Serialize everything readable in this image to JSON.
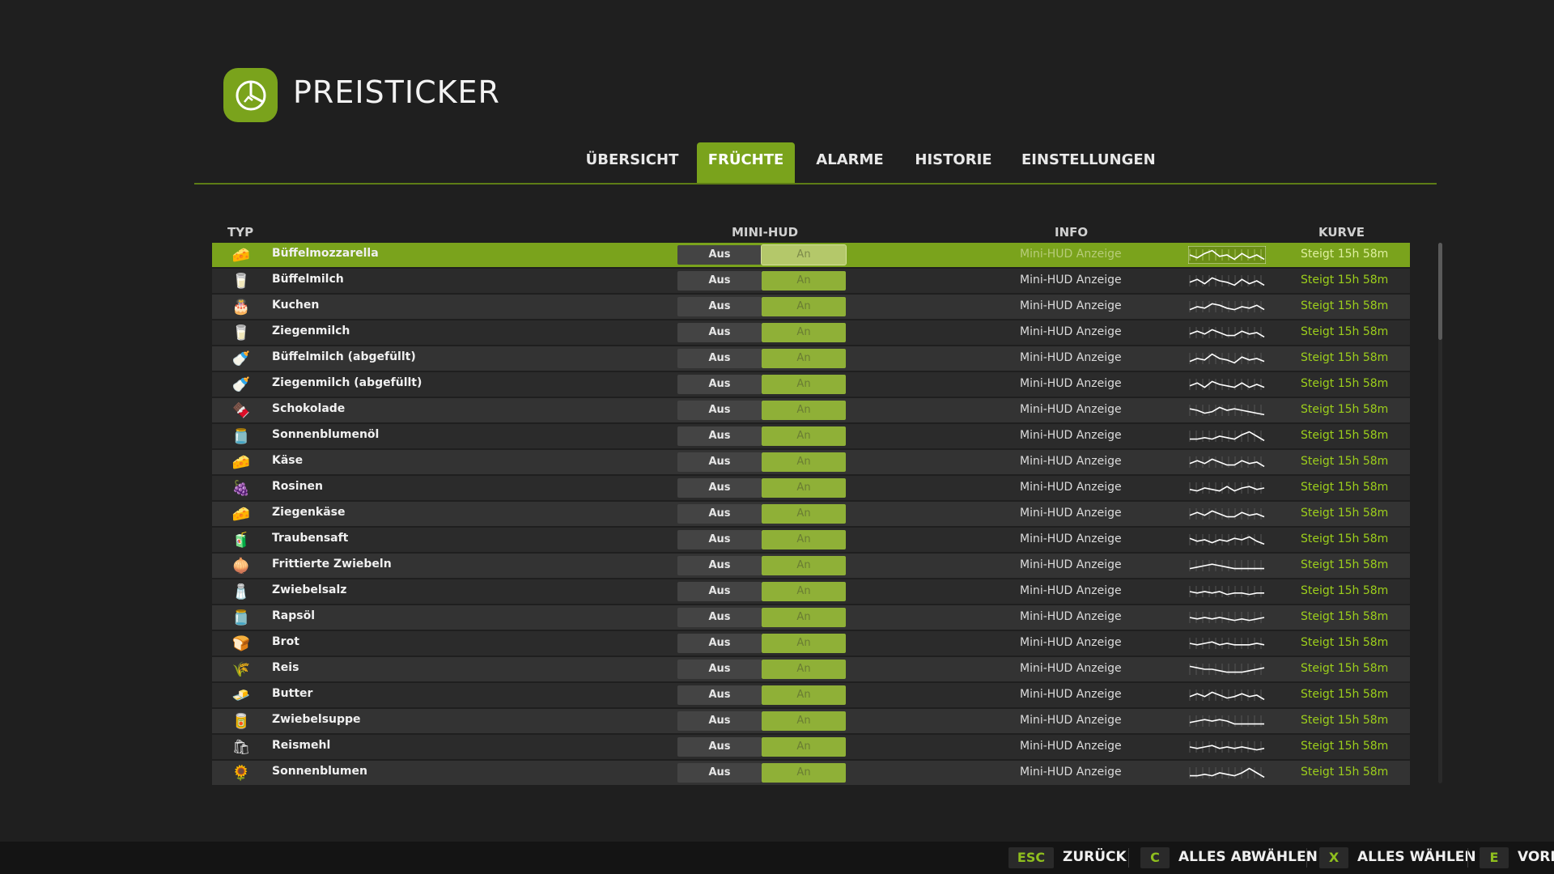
{
  "app": {
    "title": "PREISTICKER"
  },
  "tabs": [
    {
      "label": "ÜBERSICHT",
      "active": false
    },
    {
      "label": "FRÜCHTE",
      "active": true
    },
    {
      "label": "ALARME",
      "active": false
    },
    {
      "label": "HISTORIE",
      "active": false
    },
    {
      "label": "EINSTELLUNGEN",
      "active": false
    }
  ],
  "columns": {
    "typ": "TYP",
    "minihud": "MINI-HUD",
    "info": "INFO",
    "kurve": "KURVE"
  },
  "colors": {
    "accent": "#7aa31c",
    "trend": "#9dcf1c",
    "background": "#1f1f1f"
  },
  "rows": [
    {
      "name": "Büffelmozzarella",
      "icon": "mozzarella-icon",
      "glyph": "🧀",
      "off": "Aus",
      "on": "An",
      "info": "Mini-HUD Anzeige",
      "trend": "Steigt 15h 58m",
      "curve": [
        0.5,
        0.3,
        0.6,
        0.8,
        0.4,
        0.5,
        0.2,
        0.6,
        0.3,
        0.5,
        0.2
      ],
      "selected": true
    },
    {
      "name": "Büffelmilch",
      "icon": "milk-can-icon",
      "glyph": "🥛",
      "off": "Aus",
      "on": "An",
      "info": "Mini-HUD Anzeige",
      "trend": "Steigt 15h 58m",
      "curve": [
        0.4,
        0.6,
        0.3,
        0.7,
        0.5,
        0.4,
        0.2,
        0.6,
        0.3,
        0.5,
        0.2
      ]
    },
    {
      "name": "Kuchen",
      "icon": "cake-icon",
      "glyph": "🎂",
      "off": "Aus",
      "on": "An",
      "info": "Mini-HUD Anzeige",
      "trend": "Steigt 15h 58m",
      "curve": [
        0.3,
        0.5,
        0.4,
        0.7,
        0.6,
        0.4,
        0.3,
        0.5,
        0.4,
        0.6,
        0.3
      ]
    },
    {
      "name": "Ziegenmilch",
      "icon": "milk-can-icon",
      "glyph": "🥛",
      "off": "Aus",
      "on": "An",
      "info": "Mini-HUD Anzeige",
      "trend": "Steigt 15h 58m",
      "curve": [
        0.4,
        0.6,
        0.4,
        0.7,
        0.5,
        0.3,
        0.3,
        0.6,
        0.4,
        0.5,
        0.2
      ]
    },
    {
      "name": "Büffelmilch (abgefüllt)",
      "icon": "bottle-icon",
      "glyph": "🍼",
      "off": "Aus",
      "on": "An",
      "info": "Mini-HUD Anzeige",
      "trend": "Steigt 15h 58m",
      "curve": [
        0.3,
        0.5,
        0.4,
        0.8,
        0.5,
        0.4,
        0.2,
        0.6,
        0.4,
        0.5,
        0.3
      ]
    },
    {
      "name": "Ziegenmilch (abgefüllt)",
      "icon": "bottle-icon",
      "glyph": "🍼",
      "off": "Aus",
      "on": "An",
      "info": "Mini-HUD Anzeige",
      "trend": "Steigt 15h 58m",
      "curve": [
        0.4,
        0.6,
        0.3,
        0.7,
        0.5,
        0.4,
        0.3,
        0.6,
        0.3,
        0.5,
        0.3
      ]
    },
    {
      "name": "Schokolade",
      "icon": "chocolate-icon",
      "glyph": "🍫",
      "off": "Aus",
      "on": "An",
      "info": "Mini-HUD Anzeige",
      "trend": "Steigt 15h 58m",
      "curve": [
        0.6,
        0.5,
        0.3,
        0.4,
        0.7,
        0.5,
        0.6,
        0.5,
        0.4,
        0.3,
        0.2
      ]
    },
    {
      "name": "Sonnenblumenöl",
      "icon": "oil-bottle-icon",
      "glyph": "🫙",
      "off": "Aus",
      "on": "An",
      "info": "Mini-HUD Anzeige",
      "trend": "Steigt 15h 58m",
      "curve": [
        0.3,
        0.3,
        0.4,
        0.3,
        0.5,
        0.4,
        0.3,
        0.6,
        0.8,
        0.5,
        0.2
      ]
    },
    {
      "name": "Käse",
      "icon": "cheese-icon",
      "glyph": "🧀",
      "off": "Aus",
      "on": "An",
      "info": "Mini-HUD Anzeige",
      "trend": "Steigt 15h 58m",
      "curve": [
        0.4,
        0.6,
        0.4,
        0.7,
        0.5,
        0.3,
        0.3,
        0.6,
        0.4,
        0.5,
        0.2
      ]
    },
    {
      "name": "Rosinen",
      "icon": "raisins-icon",
      "glyph": "🍇",
      "off": "Aus",
      "on": "An",
      "info": "Mini-HUD Anzeige",
      "trend": "Steigt 15h 58m",
      "curve": [
        0.4,
        0.3,
        0.5,
        0.4,
        0.3,
        0.6,
        0.3,
        0.5,
        0.6,
        0.4,
        0.5
      ]
    },
    {
      "name": "Ziegenkäse",
      "icon": "goat-cheese-icon",
      "glyph": "🧀",
      "off": "Aus",
      "on": "An",
      "info": "Mini-HUD Anzeige",
      "trend": "Steigt 15h 58m",
      "curve": [
        0.4,
        0.6,
        0.4,
        0.7,
        0.5,
        0.3,
        0.3,
        0.6,
        0.4,
        0.5,
        0.3
      ]
    },
    {
      "name": "Traubensaft",
      "icon": "juice-can-icon",
      "glyph": "🧃",
      "off": "Aus",
      "on": "An",
      "info": "Mini-HUD Anzeige",
      "trend": "Steigt 15h 58m",
      "curve": [
        0.6,
        0.4,
        0.5,
        0.3,
        0.5,
        0.4,
        0.6,
        0.5,
        0.7,
        0.4,
        0.2
      ]
    },
    {
      "name": "Frittierte Zwiebeln",
      "icon": "onion-rings-icon",
      "glyph": "🧅",
      "off": "Aus",
      "on": "An",
      "info": "Mini-HUD Anzeige",
      "trend": "Steigt 15h 58m",
      "curve": [
        0.3,
        0.4,
        0.5,
        0.6,
        0.5,
        0.4,
        0.3,
        0.3,
        0.3,
        0.3,
        0.3
      ]
    },
    {
      "name": "Zwiebelsalz",
      "icon": "salt-icon",
      "glyph": "🧂",
      "off": "Aus",
      "on": "An",
      "info": "Mini-HUD Anzeige",
      "trend": "Steigt 15h 58m",
      "curve": [
        0.5,
        0.4,
        0.5,
        0.4,
        0.5,
        0.3,
        0.4,
        0.4,
        0.3,
        0.4,
        0.4
      ]
    },
    {
      "name": "Rapsöl",
      "icon": "oil-bottle-icon",
      "glyph": "🫙",
      "off": "Aus",
      "on": "An",
      "info": "Mini-HUD Anzeige",
      "trend": "Steigt 15h 58m",
      "curve": [
        0.5,
        0.4,
        0.5,
        0.4,
        0.5,
        0.4,
        0.3,
        0.4,
        0.3,
        0.4,
        0.5
      ]
    },
    {
      "name": "Brot",
      "icon": "bread-icon",
      "glyph": "🍞",
      "off": "Aus",
      "on": "An",
      "info": "Mini-HUD Anzeige",
      "trend": "Steigt 15h 58m",
      "curve": [
        0.5,
        0.4,
        0.5,
        0.6,
        0.4,
        0.5,
        0.4,
        0.4,
        0.4,
        0.5,
        0.4
      ]
    },
    {
      "name": "Reis",
      "icon": "rice-icon",
      "glyph": "🌾",
      "off": "Aus",
      "on": "An",
      "info": "Mini-HUD Anzeige",
      "trend": "Steigt 15h 58m",
      "curve": [
        0.7,
        0.6,
        0.5,
        0.5,
        0.4,
        0.3,
        0.3,
        0.3,
        0.4,
        0.5,
        0.6
      ]
    },
    {
      "name": "Butter",
      "icon": "butter-icon",
      "glyph": "🧈",
      "off": "Aus",
      "on": "An",
      "info": "Mini-HUD Anzeige",
      "trend": "Steigt 15h 58m",
      "curve": [
        0.4,
        0.6,
        0.4,
        0.7,
        0.5,
        0.3,
        0.4,
        0.6,
        0.4,
        0.5,
        0.2
      ]
    },
    {
      "name": "Zwiebelsuppe",
      "icon": "soup-can-icon",
      "glyph": "🥫",
      "off": "Aus",
      "on": "An",
      "info": "Mini-HUD Anzeige",
      "trend": "Steigt 15h 58m",
      "curve": [
        0.4,
        0.5,
        0.6,
        0.5,
        0.6,
        0.5,
        0.3,
        0.3,
        0.3,
        0.3,
        0.3
      ]
    },
    {
      "name": "Reismehl",
      "icon": "flour-bag-icon",
      "glyph": "🛍",
      "off": "Aus",
      "on": "An",
      "info": "Mini-HUD Anzeige",
      "trend": "Steigt 15h 58m",
      "curve": [
        0.5,
        0.4,
        0.5,
        0.6,
        0.4,
        0.5,
        0.4,
        0.5,
        0.4,
        0.3,
        0.4
      ]
    },
    {
      "name": "Sonnenblumen",
      "icon": "sunflower-icon",
      "glyph": "🌻",
      "off": "Aus",
      "on": "An",
      "info": "Mini-HUD Anzeige",
      "trend": "Steigt 15h 58m",
      "curve": [
        0.3,
        0.3,
        0.4,
        0.3,
        0.5,
        0.4,
        0.3,
        0.5,
        0.8,
        0.5,
        0.2
      ]
    }
  ],
  "footer": [
    {
      "key": "ESC",
      "label": "ZURÜCK"
    },
    {
      "key": "C",
      "label": "ALLES ABWÄHLEN"
    },
    {
      "key": "X",
      "label": "ALLES WÄHLEN"
    },
    {
      "key": "E",
      "label": "VORH"
    }
  ]
}
